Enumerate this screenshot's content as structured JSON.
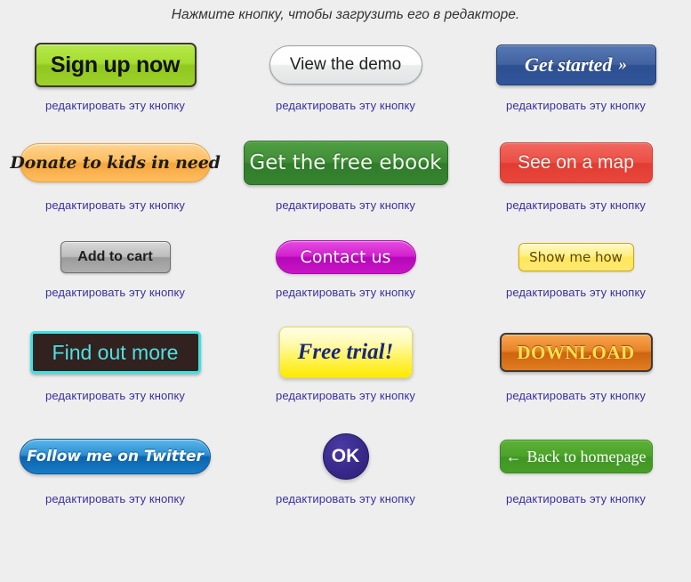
{
  "page": {
    "title": "Нажмите кнопку, чтобы загрузить его в редакторе.",
    "background_color": "#eeeeee",
    "edit_link_color": "#3b2f9e"
  },
  "edit_link_label": "редактировать эту кнопку",
  "buttons": [
    {
      "id": "sign-up-now",
      "label": "Sign up now",
      "style": "green-rect",
      "bg_color": "#a5dd2f",
      "text_color": "#111111",
      "border_color": "#3a3a28",
      "edit_label": "редактировать эту кнопку"
    },
    {
      "id": "view-the-demo",
      "label": "View the demo",
      "style": "white-pill",
      "bg_color": "#f4f5f5",
      "text_color": "#222222",
      "border_color": "#9aa0a4",
      "edit_label": "редактировать эту кнопку"
    },
    {
      "id": "get-started",
      "label": "Get started",
      "suffix": "»",
      "style": "blue-rect",
      "bg_color": "#3a5ea0",
      "text_color": "#ffffff",
      "border_color": "#24406f",
      "edit_label": "редактировать эту кнопку"
    },
    {
      "id": "donate-to-kids",
      "label": "Donate to kids in need",
      "style": "orange-pill",
      "bg_color": "#f8bb5c",
      "text_color": "#1c1c1c",
      "border_color": "#e8a13c",
      "edit_label": "редактировать эту кнопку"
    },
    {
      "id": "get-the-free-ebook",
      "label": "Get the free ebook",
      "style": "green-rect-dark",
      "bg_color": "#3b8a33",
      "text_color": "#f2fbee",
      "border_color": "#2b6b26",
      "edit_label": "редактировать эту кнопку"
    },
    {
      "id": "see-on-a-map",
      "label": "See on a map",
      "style": "red-rect",
      "bg_color": "#e84a3f",
      "text_color": "#fff4f2",
      "border_color": "#c93a31",
      "edit_label": "редактировать эту кнопку"
    },
    {
      "id": "add-to-cart",
      "label": "Add to cart",
      "style": "gray-rect",
      "bg_color": "#b4b4b4",
      "text_color": "#1f1f1f",
      "border_color": "#6f6f6f",
      "edit_label": "редактировать эту кнопку"
    },
    {
      "id": "contact-us",
      "label": "Contact us",
      "style": "magenta-pill",
      "bg_color": "#c916c6",
      "text_color": "#ffffff",
      "border_color": "#a905ab",
      "edit_label": "редактировать эту кнопку"
    },
    {
      "id": "show-me-how",
      "label": "Show me how",
      "style": "yellow-rect-small",
      "bg_color": "#ffe870",
      "text_color": "#5b4412",
      "border_color": "#d9a800",
      "edit_label": "редактировать эту кнопку"
    },
    {
      "id": "find-out-more",
      "label": "Find out more",
      "style": "dark-cyan-outline",
      "bg_color": "#31211f",
      "text_color": "#4fe0e0",
      "border_color": "#3fe2e2",
      "edit_label": "редактировать эту кнопку"
    },
    {
      "id": "free-trial",
      "label": "Free trial!",
      "style": "yellow-gradient",
      "bg_color": "#fff35a",
      "text_color": "#1b2878",
      "border_color": "#e6dc5a",
      "edit_label": "редактировать эту кнопку"
    },
    {
      "id": "download",
      "label": "DOWNLOAD",
      "style": "orange-rect",
      "bg_color": "#e07d22",
      "text_color": "#ffe14a",
      "border_color": "#3a3a3a",
      "edit_label": "редактировать эту кнопку"
    },
    {
      "id": "follow-me-on-twitter",
      "label": "Follow me on Twitter",
      "style": "blue-pill",
      "bg_color": "#1a7cc6",
      "text_color": "#ffffff",
      "border_color": "#0a5591",
      "edit_label": "редактировать эту кнопку"
    },
    {
      "id": "ok",
      "label": "OK",
      "style": "purple-circle",
      "bg_color": "#3b2c8f",
      "text_color": "#ffffff",
      "border_color": "#241a60",
      "edit_label": "редактировать эту кнопку"
    },
    {
      "id": "back-to-homepage",
      "label": "Back to homepage",
      "prefix": "←",
      "style": "green-rect-small",
      "bg_color": "#479e28",
      "text_color": "#ffffff",
      "border_color": "#3c8a20",
      "edit_label": "редактировать эту кнопку"
    }
  ]
}
